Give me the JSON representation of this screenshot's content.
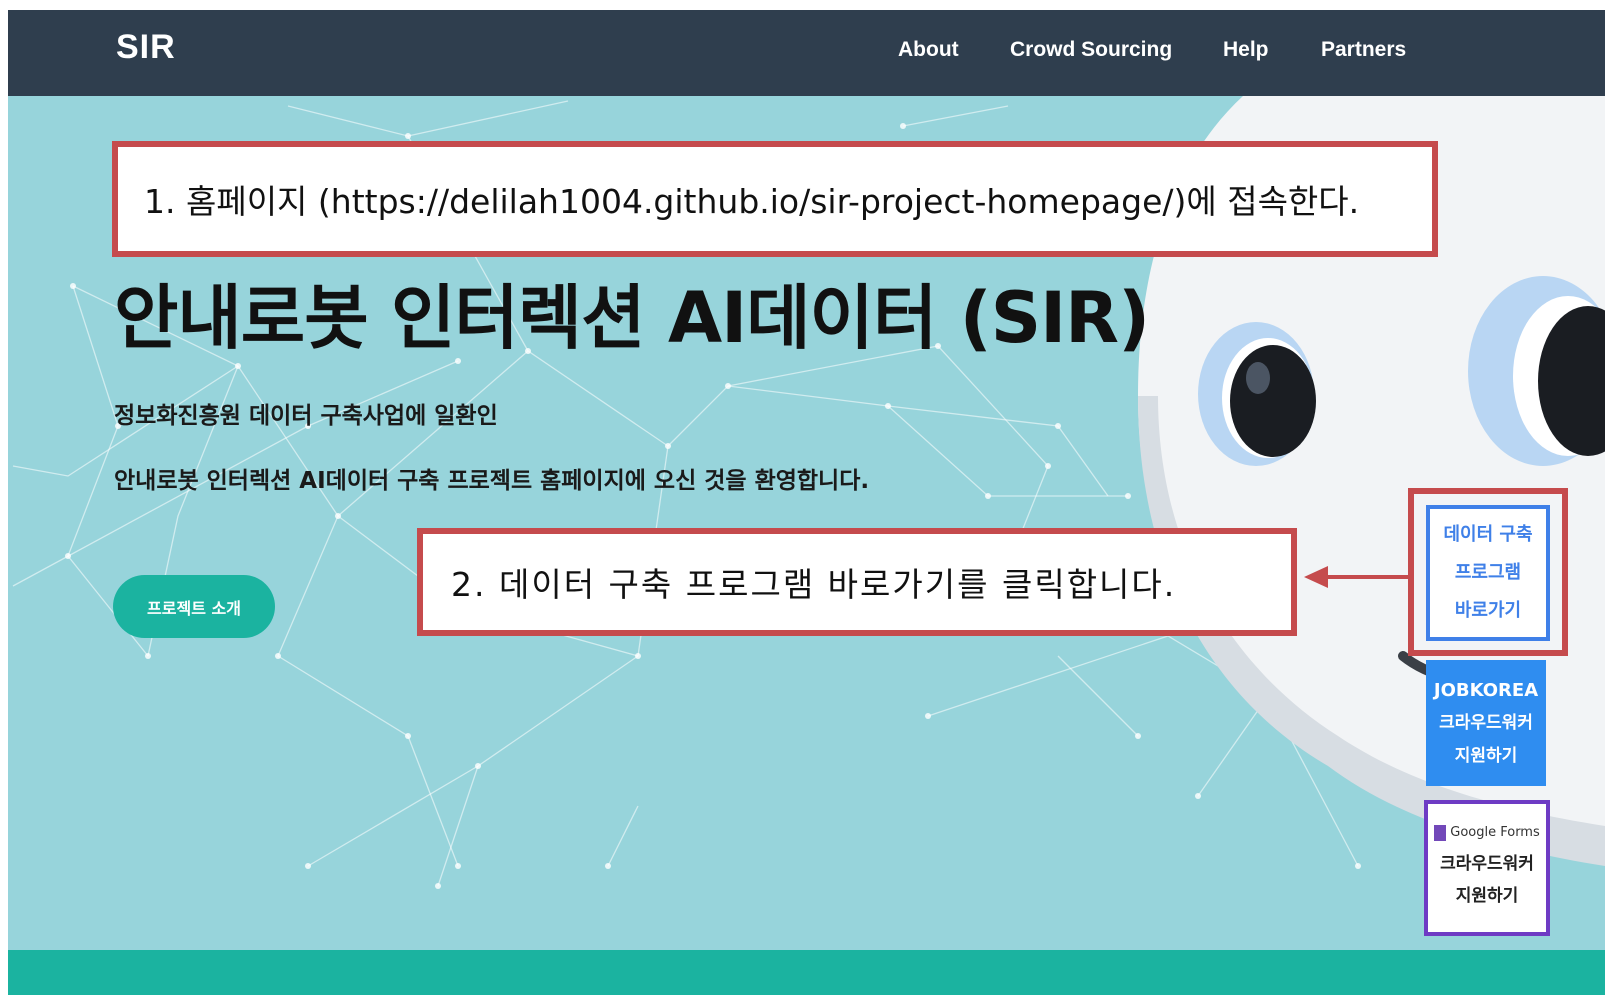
{
  "navbar": {
    "brand": "SIR",
    "links": [
      "About",
      "Crowd Sourcing",
      "Help",
      "Partners"
    ]
  },
  "hero": {
    "title": "안내로봇 인터렉션 AI데이터 (SIR)",
    "subtitle_1": "정보화진흥원 데이터 구축사업에 일환인",
    "subtitle_2": "안내로봇 인터렉션 AI데이터 구축 프로젝트 홈페이지에 오신 것을 환영합니다.",
    "cta_label": "프로젝트 소개"
  },
  "annotations": {
    "step1": "1.  홈페이지  (https://delilah1004.github.io/sir-project-homepage/)에  접속한다.",
    "step2": "2.  데이터  구축  프로그램  바로가기를  클릭합니다."
  },
  "side_buttons": {
    "data_program": [
      "데이터 구축",
      "프로그램",
      "바로가기"
    ],
    "jobkorea": [
      "JOBKOREA",
      "크라우드워커",
      "지원하기"
    ],
    "google_forms": {
      "brand": "Google Forms",
      "lines": [
        "크라우드워커",
        "지원하기"
      ]
    }
  },
  "colors": {
    "navbar": "#2f3e4e",
    "hero_bg": "#97d4db",
    "teal": "#1bb3a0",
    "annotation_red": "#c54b4d",
    "blue": "#3f80e8",
    "purple": "#6e3bc4"
  }
}
